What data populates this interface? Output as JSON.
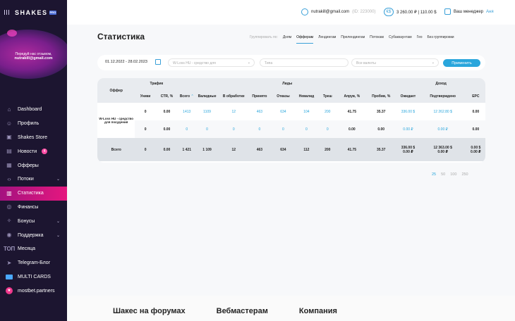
{
  "sidebar": {
    "logo": "SHAKES",
    "logo_badge": "PRO",
    "promo_line1": "Передуй нас отзывом,",
    "promo_email": "nutrakill@gmail.com",
    "nav": [
      {
        "label": "Dashboard",
        "icon": "home-icon"
      },
      {
        "label": "Профиль",
        "icon": "user-icon"
      },
      {
        "label": "Shakes Store",
        "icon": "store-icon"
      },
      {
        "label": "Новости",
        "icon": "news-icon",
        "badge": "4"
      },
      {
        "label": "Офферы",
        "icon": "offers-icon"
      },
      {
        "label": "Потоки",
        "icon": "code-icon",
        "has_chevron": true
      },
      {
        "label": "Статистика",
        "icon": "stats-icon",
        "active": true
      },
      {
        "label": "Финансы",
        "icon": "finance-icon"
      },
      {
        "label": "Бонусы",
        "icon": "bonus-icon",
        "has_chevron": true
      },
      {
        "label": "Поддержка",
        "icon": "support-icon",
        "has_chevron": true
      },
      {
        "label": "Месяца",
        "icon": "top-icon",
        "icon_text": "ТОП"
      },
      {
        "label": "Telegram-Блог",
        "icon": "telegram-icon"
      },
      {
        "label": "MULTI CARDS",
        "icon": "card-icon"
      },
      {
        "label": "mostbet.partners",
        "icon": "mostbet-icon"
      }
    ]
  },
  "header": {
    "email": "nutrakill@gmail.com",
    "user_id": "(ID: 223000)",
    "balance": "3 260.00 ₽ | 110.00 $",
    "manager_label": "Ваш менеджер",
    "manager_name": "Аня"
  },
  "main": {
    "title": "Статистика",
    "groupby_label": "Группировать по:",
    "groupby": [
      "Дням",
      "Офферам",
      "Лендингам",
      "Прелендингам",
      "Потокам",
      "Субаккаунтам",
      "Гео",
      "Без группировки"
    ],
    "groupby_selected": "Офферам",
    "filters": {
      "date_range": "01.12.2022 - 28.02.2023",
      "offer": "W-Loss HU - средство для",
      "type_placeholder": "Типа",
      "currency_placeholder": "Все валюты",
      "apply_label": "Применить"
    },
    "table": {
      "group_headers": {
        "offer": "Оффер",
        "traffic": "Трафик",
        "leads": "Лиды",
        "income": "Доход"
      },
      "columns": [
        "Уники",
        "CTR, %",
        "Всего",
        "Валидные",
        "В обработке",
        "Принято",
        "Отказы",
        "Невалид",
        "Треш",
        "Апрув, %",
        "Пробив, %",
        "Ожидает",
        "Подтверждено",
        "EPC"
      ],
      "offer_name": "W-Loss HU - средство для похудения",
      "rows": [
        [
          "0",
          "0.00",
          "1413",
          "1109",
          "12",
          "463",
          "634",
          "104",
          "200",
          "41.75",
          "35.37",
          "336.00 $",
          "12 262.80 $",
          "0.00"
        ],
        [
          "0",
          "0.00",
          "0",
          "0",
          "0",
          "0",
          "0",
          "0",
          "0",
          "0.00",
          "0.00",
          "0.00 ₽",
          "0.00 ₽",
          "0.00"
        ]
      ],
      "total": {
        "label": "Всего",
        "values": [
          "0",
          "0.00",
          "1 421",
          "1 109",
          "12",
          "463",
          "634",
          "112",
          "200",
          "41.75",
          "35.37",
          "336.00 $",
          "12 363.00 $",
          "0.00 $"
        ],
        "values_line2": [
          "0.00 ₽",
          "0.00 ₽",
          "0.00 ₽"
        ]
      }
    },
    "pager": [
      "25",
      "50",
      "100",
      "250"
    ],
    "pager_selected": "25"
  },
  "footer": {
    "cols": [
      "Шакес на форумах",
      "Вебмастерам",
      "Компания"
    ]
  },
  "colors": {
    "sidebar_bg": "#1c1530",
    "active_nav": "#e5177f",
    "accent": "#2aa6dc"
  }
}
